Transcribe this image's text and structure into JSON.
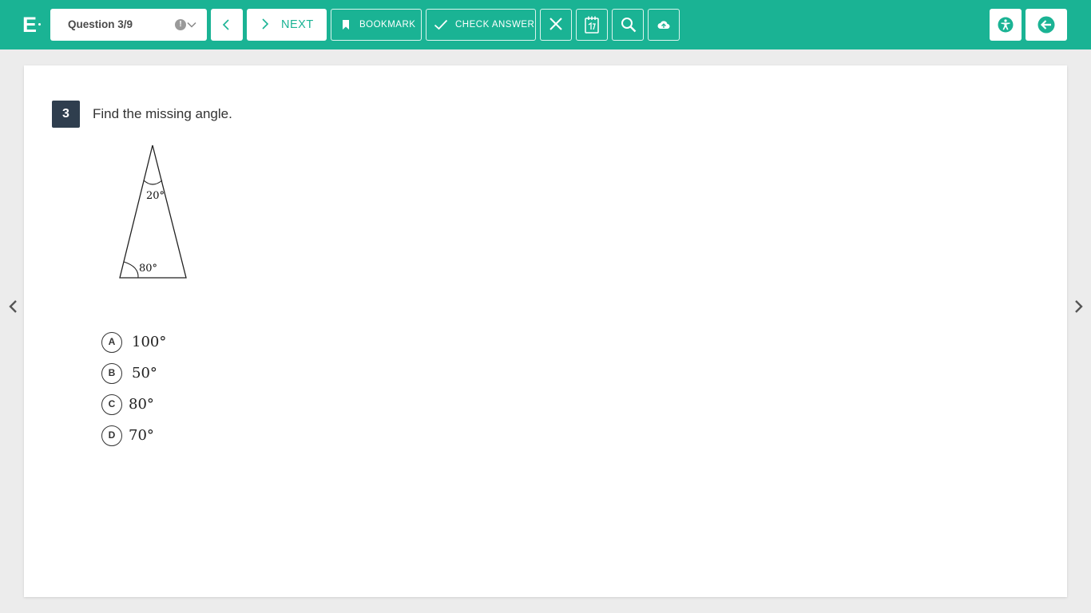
{
  "header": {
    "logo_letter": "E",
    "question_selector": "Question 3/9",
    "info_glyph": "!",
    "next_label": "NEXT",
    "bookmark_label": "BOOKMARK",
    "check_answer_label": "CHECK ANSWER"
  },
  "icons": {
    "prev": "chevron-left-icon",
    "next": "chevron-right-icon",
    "bookmark": "bookmark-icon",
    "check": "checkmark-icon",
    "close": "close-icon",
    "calculator": "calculator-icon",
    "search": "magnifier-icon",
    "upload": "cloud-upload-icon",
    "accessibility": "accessibility-icon",
    "exit": "exit-arrow-icon"
  },
  "question": {
    "number": "3",
    "text": "Find the missing angle.",
    "figure": {
      "apex_angle": "20°",
      "base_angle": "80°"
    },
    "choices": [
      {
        "letter": "A",
        "value": "100°"
      },
      {
        "letter": "B",
        "value": "50°"
      },
      {
        "letter": "C",
        "value": "80°"
      },
      {
        "letter": "D",
        "value": "70°"
      }
    ]
  },
  "colors": {
    "accent": "#1ab394",
    "question_badge": "#2f3e4e",
    "background": "#ececec"
  }
}
